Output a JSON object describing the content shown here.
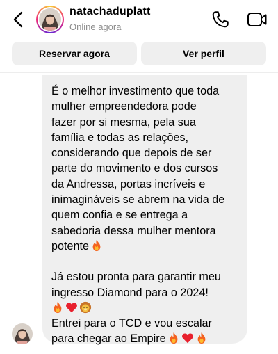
{
  "header": {
    "username": "natachaduplatt",
    "status": "Online agora",
    "icons": {
      "back": "chevron-left-icon",
      "call": "phone-icon",
      "video": "video-camera-icon"
    }
  },
  "actions": {
    "book_label": "Reservar agora",
    "profile_label": "Ver perfil"
  },
  "message": {
    "paragraph1": "É o melhor investimento que toda\nmulher empreendedora pode\nfazer por si mesma, pela sua\nfamília e todas as relações,\nconsiderando que depois de ser\nparte do movimento e dos cursos\nda Andressa, portas incríveis e\ninimagináveis se abrem na vida de\nquem confia e se entrega a\nsabedoria dessa mulher mentora\npotente",
    "paragraph2": "Já estou pronta para garantir meu\ningresso Diamond para o 2024!",
    "paragraph3": "Entrei para o TCD e vou escalar\npara chegar ao Empire",
    "emojis": {
      "after_p1": [
        "fire"
      ],
      "after_p2": [
        "fire",
        "red-heart",
        "lion"
      ],
      "after_p3": [
        "fire",
        "red-heart",
        "fire"
      ]
    }
  },
  "colors": {
    "bubble": "#efefef",
    "button": "#efefef",
    "status": "#8e8e8e"
  }
}
